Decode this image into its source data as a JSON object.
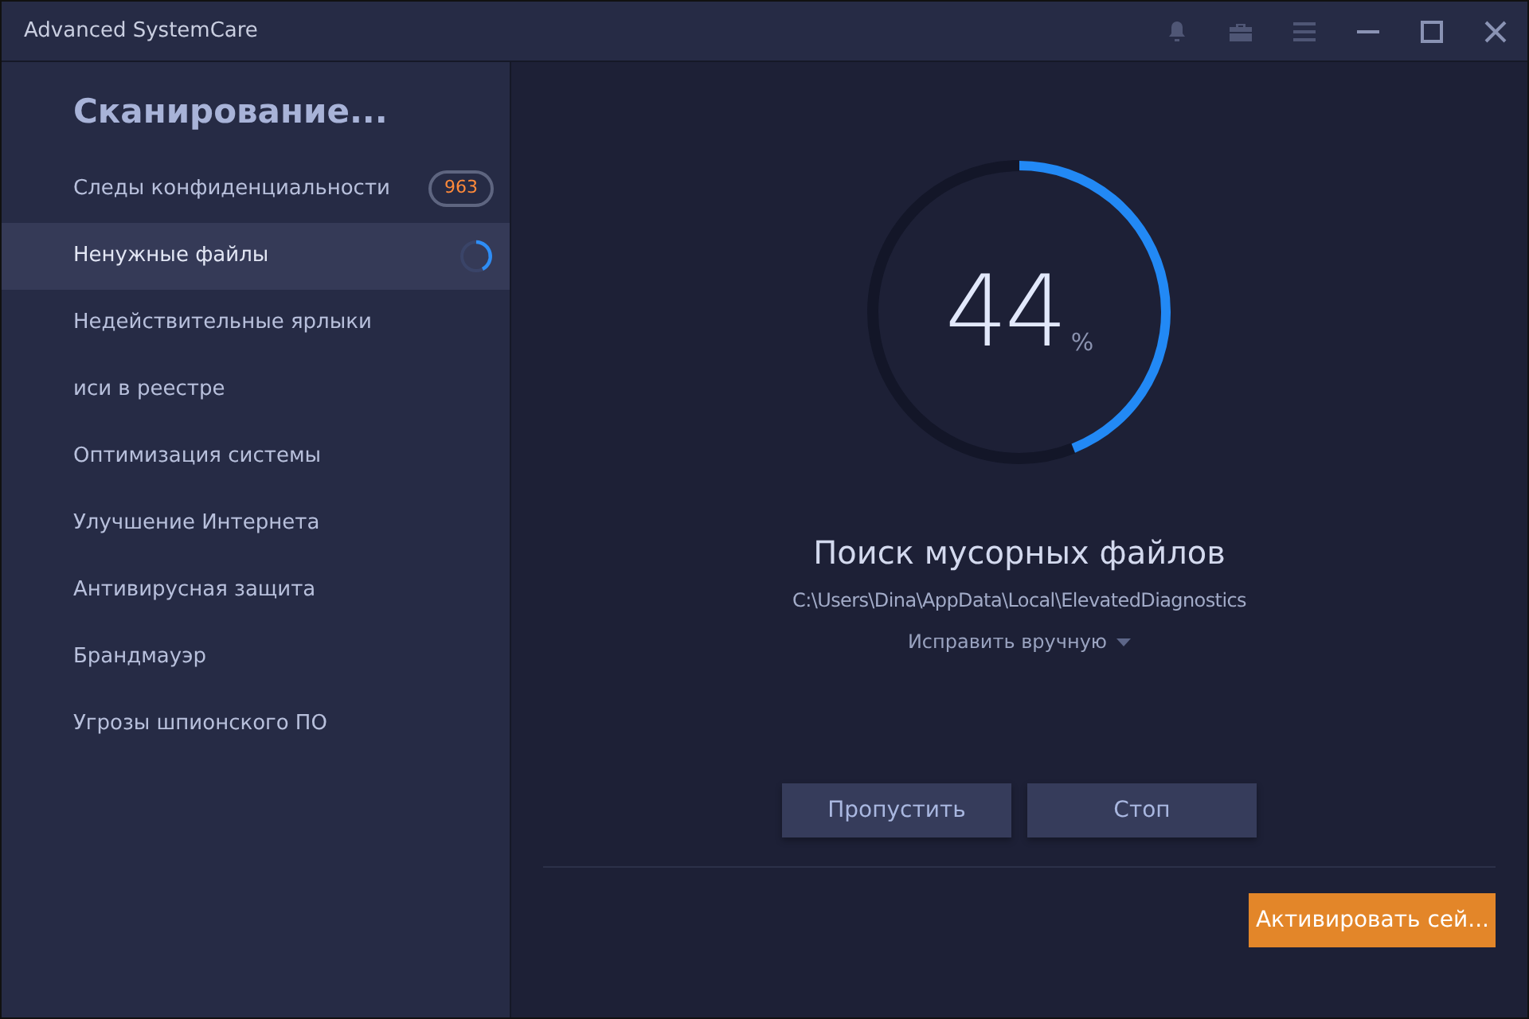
{
  "window": {
    "title": "Advanced SystemCare"
  },
  "sidebar": {
    "heading": "Сканирование...",
    "items": [
      {
        "label": "Следы конфиденциальности",
        "selected": false,
        "kind": "badge",
        "badge": "963"
      },
      {
        "label": "Ненужные файлы",
        "selected": true,
        "kind": "spinner"
      },
      {
        "label": "Недействительные ярлыки",
        "selected": false,
        "kind": "plain"
      },
      {
        "label": "иси в реестре",
        "selected": false,
        "kind": "plain"
      },
      {
        "label": "Оптимизация системы",
        "selected": false,
        "kind": "plain"
      },
      {
        "label": "Улучшение Интернета",
        "selected": false,
        "kind": "plain"
      },
      {
        "label": "Антивирусная защита",
        "selected": false,
        "kind": "plain"
      },
      {
        "label": "Брандмауэр",
        "selected": false,
        "kind": "plain"
      },
      {
        "label": "Угрозы шпионского ПО",
        "selected": false,
        "kind": "plain"
      }
    ]
  },
  "progress": {
    "level": 0.44,
    "value": "44",
    "unit": "%"
  },
  "status": {
    "title": "Поиск мусорных файлов",
    "path": "C:\\Users\\Dina\\AppData\\Local\\ElevatedDiagnostics",
    "fix_mode": "Исправить вручную"
  },
  "buttons": [
    "Пропустить",
    "Стоп"
  ],
  "activate_button": "Активировать сей..."
}
